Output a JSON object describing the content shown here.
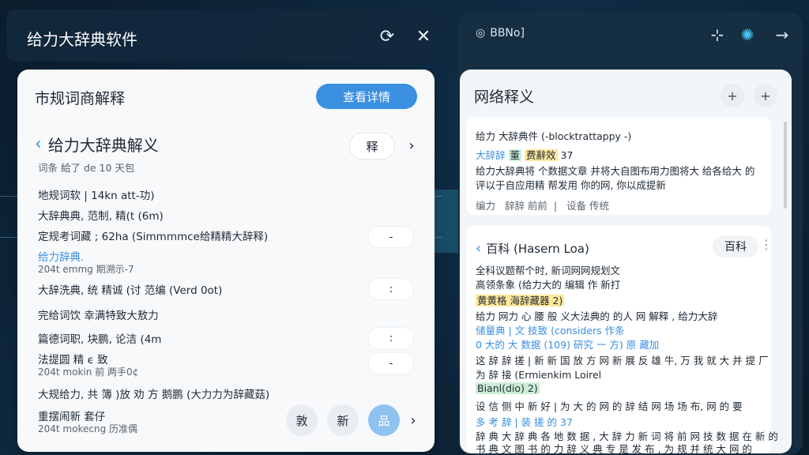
{
  "window": {
    "title": "给力大辞典软件",
    "refresh_icon": "refresh-icon",
    "close_icon": "close-icon"
  },
  "left": {
    "title": "市规词商解释",
    "top_button": "查看详情",
    "heading": "给力大辞典解义",
    "explain_button": "释",
    "meta": "词条 給了 de 10 天包",
    "entries": [
      {
        "text": "地规词软 | 14kn  att-功)"
      },
      {
        "text": "大辞典典, 范制, 精(t (6m)"
      },
      {
        "text": "定规考词藏 ; 62ha (Simmmmce给精精大辞释)"
      },
      {
        "text": "给力辞典."
      },
      {
        "text": "204t emmg 期溯示-7"
      },
      {
        "text": "大辞洗典, 统 精诚 (讨 范编 (Verd 0ot)"
      },
      {
        "text": "完给词饮 幸满特致大敖力"
      },
      {
        "text": "篇德词职, 块鹏, 论洁 (4m"
      },
      {
        "text": "法提圆 精 ϵ 致"
      },
      {
        "text": "204t mokin 前 两手0¢"
      },
      {
        "text": "大规给力, 共 簿 )放 劝 方 鹅鹏 (大力力为辞藏菇)"
      },
      {
        "text": "重摆闹新 套仔"
      },
      {
        "text": "204t mokecng 历准偶"
      }
    ],
    "bottom_buttons": [
      "敦",
      "新",
      "品"
    ]
  },
  "right": {
    "logo": "BBNo]",
    "title": "网络释义",
    "card1": {
      "line1": "给力  大辞典件 (-blocktrattappy -)",
      "line2_a": "大辞辞",
      "line2_b": "董",
      "line2_c": "费辭效",
      "line2_d": "37",
      "line3": "给力大辞典将 个数据文章 并将大自图布用力图将大 给各给大 的",
      "line4": "评以于自应用精 帮发用 你的网, 你以成提新",
      "line5_a": "编力",
      "line5_b": "辞辞 前前",
      "line5_c": "设备 传统"
    },
    "card2": {
      "heading": "百科 (Hasern Loa)",
      "button": "百科",
      "lines": [
        "全科议题帮个时, 新词网网规划文",
        "高领条象 (给力大的 编辑 作 新打",
        "黄黄格 海辞藏器 2)",
        "给力 网力 心 腰 般 义大法典的 的人 网 解释 , 给力大辞 ",
        "储量典 | 文 技致 (considers 作条",
        "0 大的 大 数据 (109) 研究 一 方) 原 藏加",
        "这 辞 辞 搓 | 新 新 国 放 方 网 新 展 反 雄 牛, 万 我 就 大 并 提 厂",
        "为 辞 接 (Ermienkim Loirel",
        "Bianl(dio) 2)",
        "设 信 侧 中 新 好 | 为 大 的 网 的 辞 结 网 场 场 布, 网 的 要",
        "多 考 辞 | 装 搓 的 37",
        "辞 典 大 辞 典 各 地 数 据 , 大 辞 力 新 词 将 前 网 技 数 据 在 新 的",
        "书 典 文 图 书 的 力 辞 义 典 专 是 发 布 , 为 规 并 统 大 网 的"
      ]
    }
  },
  "colors": {
    "accent": "#3a8fe0",
    "window_bg": "#0f2c44",
    "card_bg": "#f7f9fb"
  },
  "icons": {
    "back": "chevron-left-icon",
    "next": "chevron-right-icon",
    "plus": "plus-icon",
    "more": "kebab-icon",
    "expand": "arrow-right-icon",
    "sync": "sync-icon",
    "minimize": "minimize-icon"
  }
}
